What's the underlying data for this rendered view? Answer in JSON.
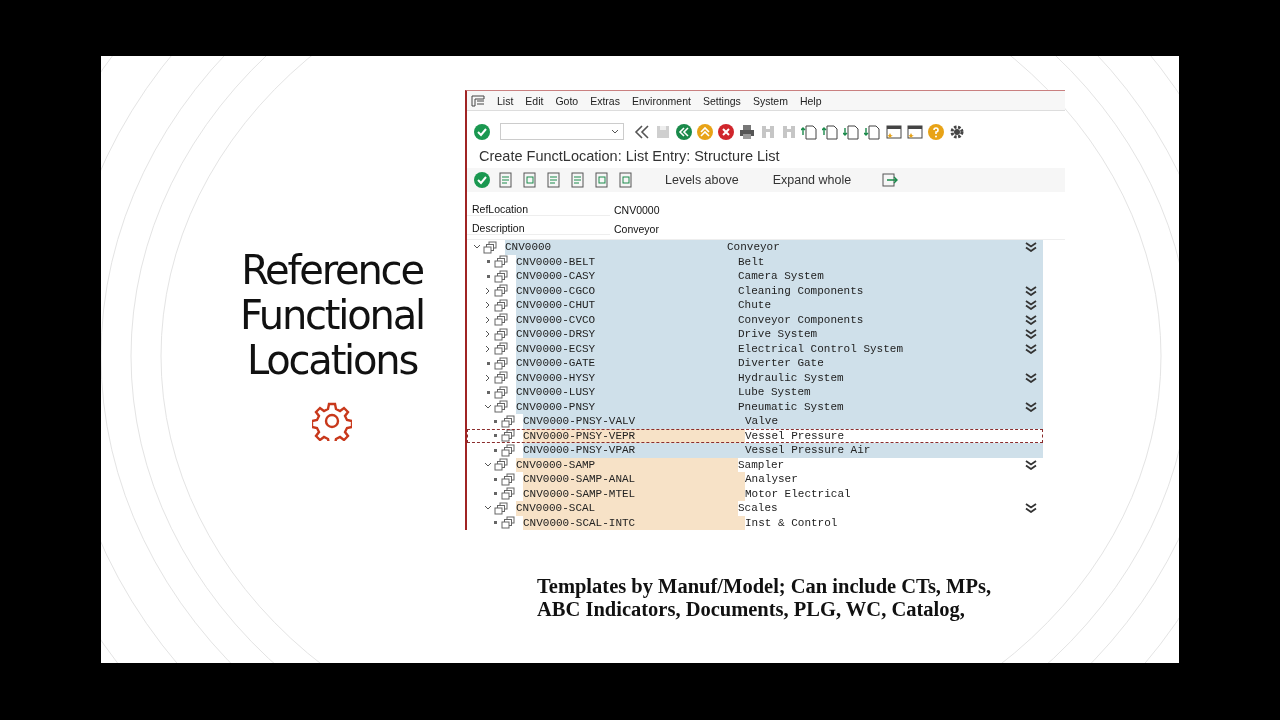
{
  "slide": {
    "title": "Reference Functional Locations",
    "caption": "Templates by Manuf/Model; Can include CTs, MPs,\nABC Indicators, Documents, PLG, WC, Catalog,"
  },
  "window": {
    "menu": [
      "List",
      "Edit",
      "Goto",
      "Extras",
      "Environment",
      "Settings",
      "System",
      "Help"
    ],
    "title": "Create FunctLocation: List Entry: Structure List",
    "toolbar_buttons": [
      "Levels above",
      "Expand whole"
    ],
    "fields": [
      {
        "label": "RefLocation",
        "value": "CNV0000"
      },
      {
        "label": "Description",
        "value": "Conveyor"
      }
    ],
    "tree": [
      {
        "code": "CNV0000",
        "description": "Conveyor",
        "kind": "branch",
        "expanded": true,
        "selected": true,
        "focused": false,
        "children": [
          {
            "code": "CNV0000-BELT",
            "description": "Belt",
            "kind": "leaf",
            "selected": true,
            "focused": false
          },
          {
            "code": "CNV0000-CASY",
            "description": "Camera System",
            "kind": "leaf",
            "selected": true,
            "focused": false
          },
          {
            "code": "CNV0000-CGCO",
            "description": "Cleaning Components",
            "kind": "branch",
            "expanded": false,
            "selected": true,
            "focused": false
          },
          {
            "code": "CNV0000-CHUT",
            "description": "Chute",
            "kind": "branch",
            "expanded": false,
            "selected": true,
            "focused": false
          },
          {
            "code": "CNV0000-CVCO",
            "description": "Conveyor Components",
            "kind": "branch",
            "expanded": false,
            "selected": true,
            "focused": false
          },
          {
            "code": "CNV0000-DRSY",
            "description": "Drive System",
            "kind": "branch",
            "expanded": false,
            "selected": true,
            "focused": false
          },
          {
            "code": "CNV0000-ECSY",
            "description": "Electrical Control System",
            "kind": "branch",
            "expanded": false,
            "selected": true,
            "focused": false
          },
          {
            "code": "CNV0000-GATE",
            "description": "Diverter Gate",
            "kind": "leaf",
            "selected": true,
            "focused": false
          },
          {
            "code": "CNV0000-HYSY",
            "description": "Hydraulic System",
            "kind": "branch",
            "expanded": false,
            "selected": true,
            "focused": false
          },
          {
            "code": "CNV0000-LUSY",
            "description": "Lube System",
            "kind": "leaf",
            "selected": true,
            "focused": false
          },
          {
            "code": "CNV0000-PNSY",
            "description": "Pneumatic System",
            "kind": "branch",
            "expanded": true,
            "selected": true,
            "focused": false,
            "children": [
              {
                "code": "CNV0000-PNSY-VALV",
                "description": "Valve",
                "kind": "leaf",
                "selected": true,
                "focused": false
              },
              {
                "code": "CNV0000-PNSY-VEPR",
                "description": "Vessel Pressure",
                "kind": "leaf",
                "selected": false,
                "focused": true
              },
              {
                "code": "CNV0000-PNSY-VPAR",
                "description": "Vessel Pressure Air",
                "kind": "leaf",
                "selected": true,
                "focused": false
              }
            ]
          },
          {
            "code": "CNV0000-SAMP",
            "description": "Sampler",
            "kind": "branch",
            "expanded": true,
            "selected": false,
            "focused": false,
            "children": [
              {
                "code": "CNV0000-SAMP-ANAL",
                "description": "Analyser",
                "kind": "leaf",
                "selected": false,
                "focused": false
              },
              {
                "code": "CNV0000-SAMP-MTEL",
                "description": "Motor Electrical",
                "kind": "leaf",
                "selected": false,
                "focused": false
              }
            ]
          },
          {
            "code": "CNV0000-SCAL",
            "description": "Scales",
            "kind": "branch",
            "expanded": true,
            "selected": false,
            "focused": false,
            "children": [
              {
                "code": "CNV0000-SCAL-INTC",
                "description": "Inst & Control",
                "kind": "leaf",
                "selected": false,
                "focused": false
              }
            ]
          }
        ]
      }
    ]
  }
}
